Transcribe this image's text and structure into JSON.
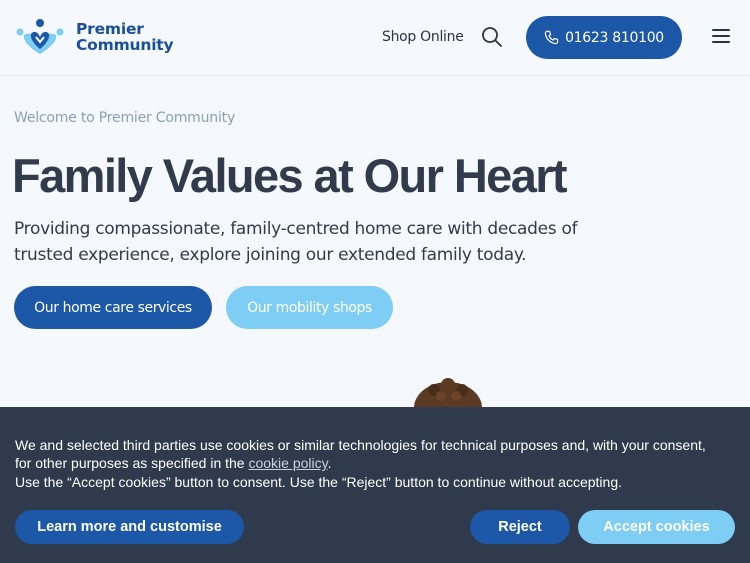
{
  "header": {
    "logo_line1": "Premier",
    "logo_line2": "Community",
    "shop_link": "Shop Online",
    "phone": "01623 810100"
  },
  "hero": {
    "eyebrow": "Welcome to Premier Community",
    "headline": "Family Values at Our Heart",
    "lead": "Providing compassionate, family-centred home care with decades of trusted experience, explore joining our extended family today.",
    "primary_button": "Our home care services",
    "secondary_button": "Our mobility shops"
  },
  "cookie_banner": {
    "text_before_link": "We and selected third parties use cookies or similar technologies for technical purposes and, with your consent, for other purposes as specified in the ",
    "link_text": "cookie policy",
    "text_after_link": ".",
    "line2": "Use the “Accept cookies” button to consent. Use the “Reject” button to continue without accepting.",
    "learn_button": "Learn more and customise",
    "reject_button": "Reject",
    "accept_button": "Accept cookies"
  },
  "colors": {
    "brand_blue": "#1c57a8",
    "light_blue": "#7dcdf5",
    "banner_bg": "#2f3b4d",
    "page_bg": "#f5f8fc"
  },
  "icons": [
    "logo-mark",
    "search-icon",
    "phone-icon",
    "menu-icon"
  ]
}
